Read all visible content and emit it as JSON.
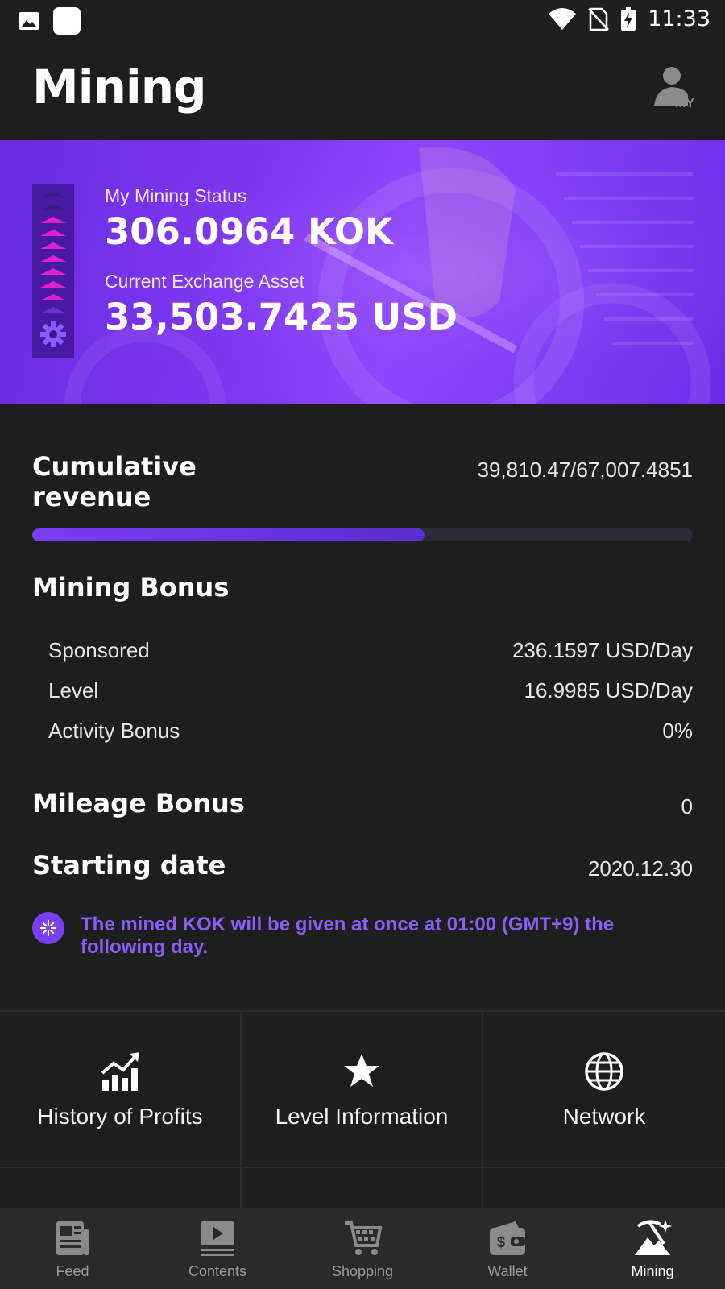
{
  "status_bar": {
    "time": "11:33"
  },
  "header": {
    "title": "Mining",
    "my_badge": "MY"
  },
  "banner": {
    "status_label": "My Mining Status",
    "status_value": "306.0964 KOK",
    "asset_label": "Current Exchange Asset",
    "asset_value": "33,503.7425 USD"
  },
  "cumulative": {
    "title_line1": "Cumulative",
    "title_line2": "revenue",
    "value": "39,810.47/67,007.4851",
    "progress": 0.594
  },
  "mining_bonus": {
    "title": "Mining Bonus",
    "items": [
      {
        "label": "Sponsored",
        "value": "236.1597 USD/Day"
      },
      {
        "label": "Level",
        "value": "16.9985 USD/Day"
      },
      {
        "label": "Activity Bonus",
        "value": "0%"
      }
    ]
  },
  "mileage_bonus": {
    "title": "Mileage Bonus",
    "value": "0"
  },
  "starting_date": {
    "title": "Starting date",
    "value": "2020.12.30"
  },
  "notice": {
    "text": "The mined KOK will be given at once at 01:00 (GMT+9) the following day."
  },
  "menu": [
    {
      "label": "History of Profits",
      "icon": "chart-up-icon"
    },
    {
      "label": "Level Information",
      "icon": "star-icon"
    },
    {
      "label": "Network",
      "icon": "globe-icon"
    }
  ],
  "bottom_nav": [
    {
      "label": "Feed",
      "icon": "newspaper-icon"
    },
    {
      "label": "Contents",
      "icon": "play-screen-icon"
    },
    {
      "label": "Shopping",
      "icon": "cart-icon"
    },
    {
      "label": "Wallet",
      "icon": "wallet-icon"
    },
    {
      "label": "Mining",
      "icon": "pickaxe-icon",
      "active": true
    }
  ],
  "colors": {
    "accent": "#7a3ef0",
    "notice_text": "#8b5cf6",
    "background": "#1e1e1e",
    "nav_bg": "#2a2a2a"
  }
}
